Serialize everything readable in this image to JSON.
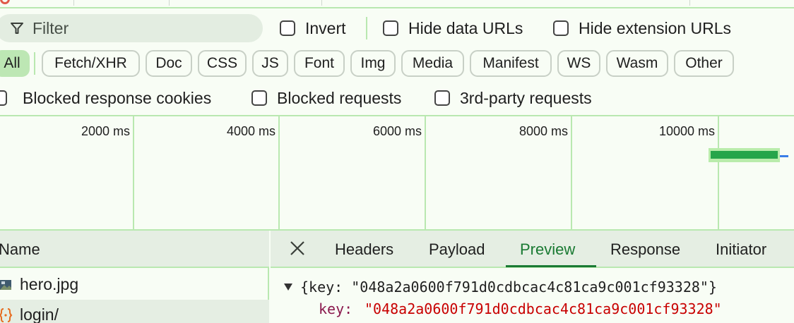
{
  "filter": {
    "placeholder": "Filter",
    "invert_label": "Invert",
    "hide_data_urls_label": "Hide data URLs",
    "hide_extension_urls_label": "Hide extension URLs"
  },
  "type_chips": [
    "All",
    "Fetch/XHR",
    "Doc",
    "CSS",
    "JS",
    "Font",
    "Img",
    "Media",
    "Manifest",
    "WS",
    "Wasm",
    "Other"
  ],
  "active_chip": "All",
  "options": {
    "blocked_cookies_label": "Blocked response cookies",
    "blocked_requests_label": "Blocked requests",
    "third_party_label": "3rd-party requests"
  },
  "timeline": {
    "ticks": [
      "2000 ms",
      "4000 ms",
      "6000 ms",
      "8000 ms",
      "10000 ms"
    ]
  },
  "requests": {
    "header": "Name",
    "items": [
      {
        "name": "hero.jpg",
        "icon": "image-file-icon"
      },
      {
        "name": "login/",
        "icon": "json-braces-icon"
      }
    ]
  },
  "detail": {
    "tabs": [
      "Headers",
      "Payload",
      "Preview",
      "Response",
      "Initiator"
    ],
    "active_tab": "Preview",
    "preview": {
      "summary": "{key: \"048a2a0600f791d0cdbcac4c81ca9c001cf93328\"}",
      "key_name": "key:",
      "key_value": "\"048a2a0600f791d0cdbcac4c81ca9c001cf93328\""
    }
  },
  "colors": {
    "accent_green": "#1a7a33",
    "active_chip_bg": "#bde7b4",
    "waterfall_bar": "#26a54a",
    "grid": "#b9e8b0"
  }
}
